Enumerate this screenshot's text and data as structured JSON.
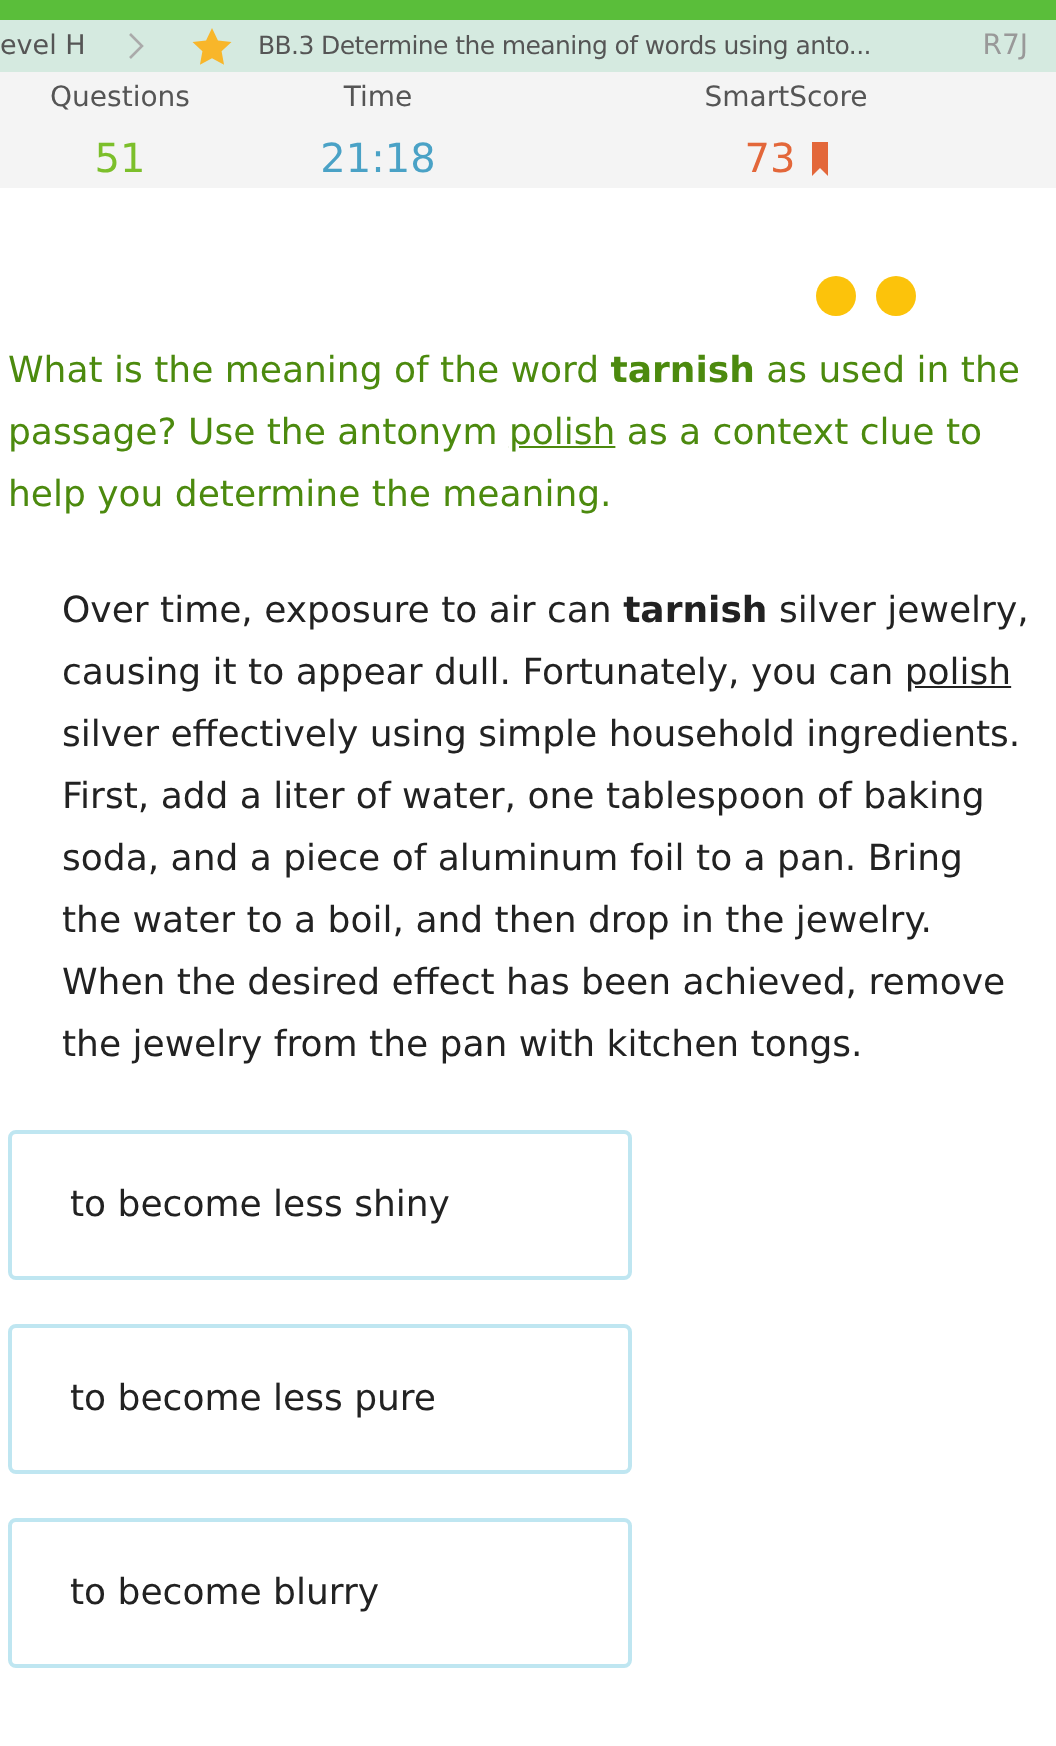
{
  "breadcrumb": {
    "level": "evel H",
    "skill": "BB.3 Determine the meaning of words using anto...",
    "code": "R7J"
  },
  "stats": [
    {
      "label": "Questions",
      "value": "51",
      "kind": "questions"
    },
    {
      "label": "Time",
      "value": "21:18",
      "kind": "time"
    },
    {
      "label": "SmartScore",
      "value": "73",
      "kind": "score"
    }
  ],
  "question": [
    {
      "text": "What is the meaning of the word ",
      "kind": "plain"
    },
    {
      "text": "tarnish",
      "kind": "bold"
    },
    {
      "text": " as used in the passage? Use the antonym ",
      "kind": "plain"
    },
    {
      "text": "polish",
      "kind": "underline"
    },
    {
      "text": " as a context clue to help you determine the meaning.",
      "kind": "plain"
    }
  ],
  "passage": [
    {
      "text": "Over time, exposure to air can ",
      "kind": "plain"
    },
    {
      "text": "tarnish",
      "kind": "bold"
    },
    {
      "text": " silver jewelry, causing it to appear dull. Fortunately, you can ",
      "kind": "plain"
    },
    {
      "text": "polish",
      "kind": "underline"
    },
    {
      "text": " silver effectively using simple household ingredients. First, add a liter of water, one tablespoon of baking soda, and a piece of aluminum foil to a pan. Bring the water to a boil, and then drop in the jewelry. When the desired effect has been achieved, remove the jewelry from the pan with kitchen tongs.",
      "kind": "plain"
    }
  ],
  "choices": [
    {
      "label": "to become less shiny",
      "selected": false
    },
    {
      "label": "to become less pure",
      "selected": false
    },
    {
      "label": "to become blurry",
      "selected": false
    }
  ]
}
